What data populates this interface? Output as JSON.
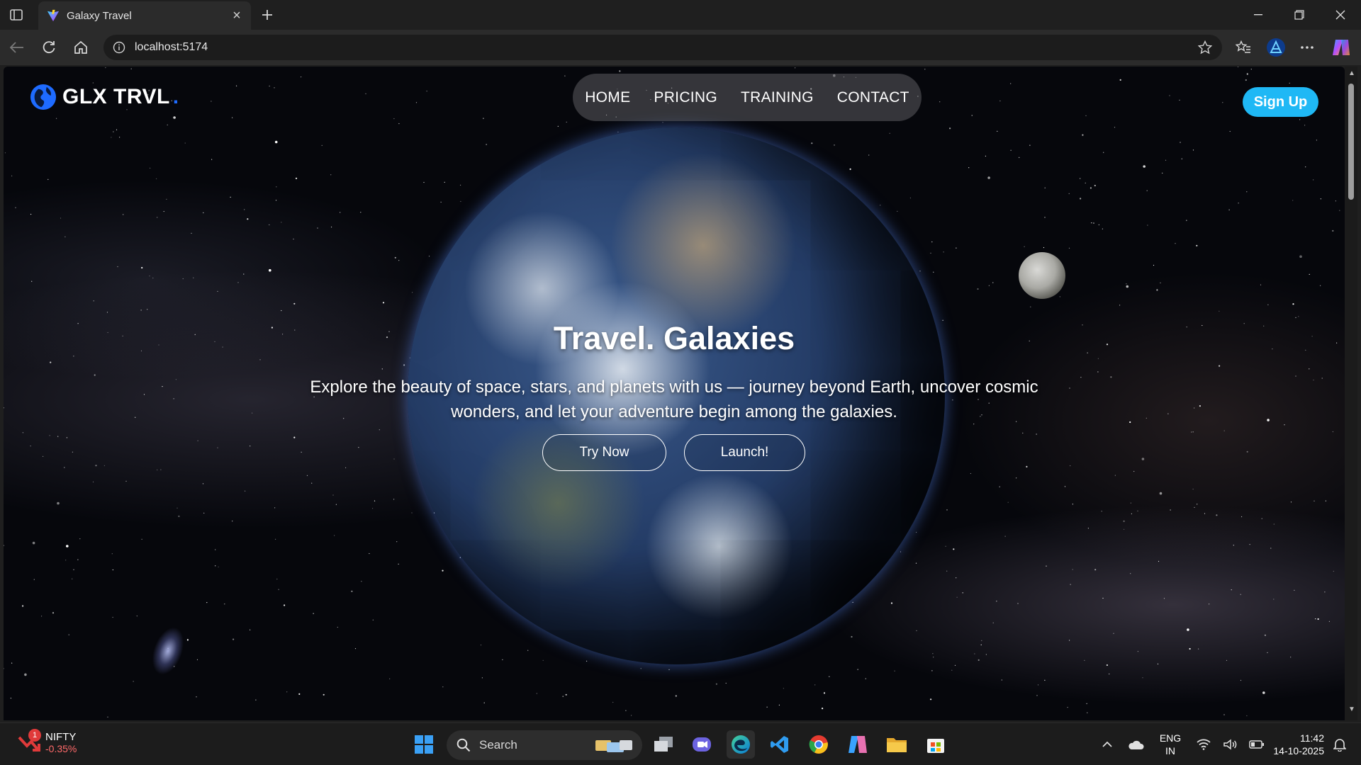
{
  "browser": {
    "tab_title": "Galaxy Travel",
    "address": "localhost:5174"
  },
  "site": {
    "logo_text": "GLX TRVL",
    "logo_dot": ".",
    "nav": [
      "HOME",
      "PRICING",
      "TRAINING",
      "CONTACT"
    ],
    "signup_label": "Sign Up",
    "hero_title": "Travel. Galaxies",
    "hero_subtitle": "Explore the beauty of space, stars, and planets with us — journey beyond Earth, uncover cosmic wonders, and let your adventure begin among the galaxies.",
    "btn_try": "Try Now",
    "btn_launch": "Launch!"
  },
  "taskbar": {
    "stock_name": "NIFTY",
    "stock_change": "-0.35%",
    "stock_badge": "1",
    "search_label": "Search",
    "lang_top": "ENG",
    "lang_bottom": "IN",
    "time": "11:42",
    "date": "14-10-2025"
  },
  "colors": {
    "accent": "#1fb8f5",
    "logo_dot": "#1e6bff",
    "stock_down": "#ff6a6a"
  }
}
